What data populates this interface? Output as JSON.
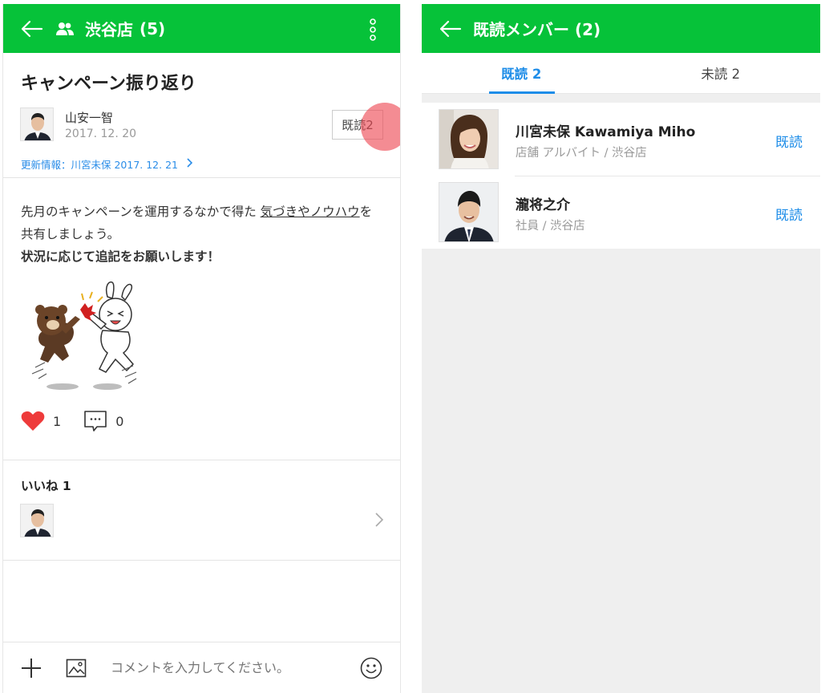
{
  "left": {
    "header": {
      "title": "渋谷店",
      "count": "(5)"
    },
    "post": {
      "title": "キャンペーン振り返り",
      "author": {
        "name": "山安一智",
        "date": "2017. 12. 20"
      },
      "read_button": "既読2",
      "update_info": "更新情報：川宮未保  2017. 12. 21",
      "body_line1a": "先月のキャンペーンを運用するなかで得た ",
      "body_link": "気づきやノウハウ",
      "body_line2b": "を共有しましょう。",
      "body_line3": "状況に応じて追記をお願いします！"
    },
    "reactions": {
      "likes": "1",
      "comments": "0"
    },
    "likes_section": {
      "header": "いいね 1"
    },
    "composer": {
      "placeholder": "コメントを入力してください。"
    }
  },
  "right": {
    "header": {
      "title": "既読メンバー (2)"
    },
    "tabs": [
      {
        "label": "既読 2"
      },
      {
        "label": "未読 2"
      }
    ],
    "members": [
      {
        "name": "川宮未保 Kawamiya Miho",
        "role": "店舗 アルバイト / 渋谷店",
        "status": "既読"
      },
      {
        "name": "瀧将之介",
        "role": "社員 / 渋谷店",
        "status": "既読"
      }
    ]
  },
  "colors": {
    "header_green": "#06c239",
    "accent_blue": "#1e8de8",
    "heart_red": "#ee3b3b",
    "tap_indicator": "#ee4650"
  },
  "icons": [
    "back-arrow-icon",
    "group-icon",
    "kebab-menu-icon",
    "heart-icon",
    "comment-icon",
    "chevron-right-icon",
    "plus-icon",
    "image-icon",
    "emoji-icon"
  ]
}
